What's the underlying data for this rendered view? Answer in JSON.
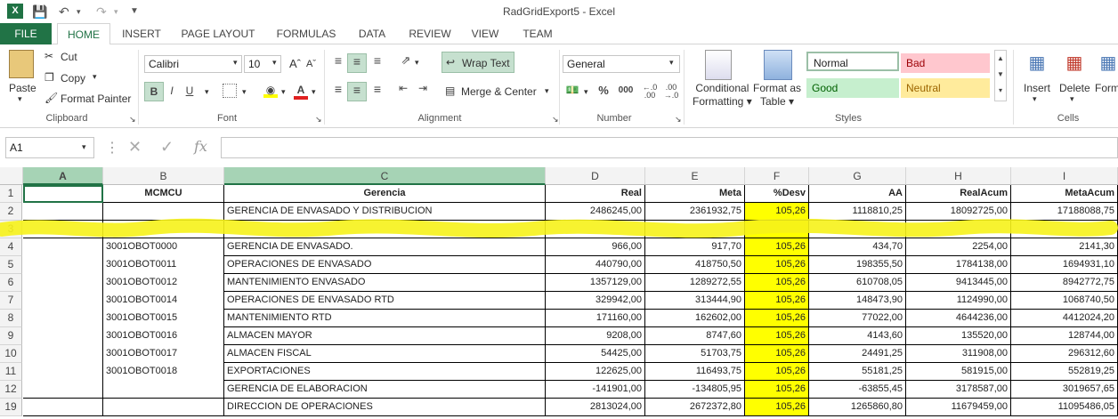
{
  "window": {
    "title": "RadGridExport5 - Excel"
  },
  "tabs": [
    "FILE",
    "HOME",
    "INSERT",
    "PAGE LAYOUT",
    "FORMULAS",
    "DATA",
    "REVIEW",
    "VIEW",
    "TEAM"
  ],
  "clipboard": {
    "paste": "Paste",
    "cut": "Cut",
    "copy": "Copy",
    "format_painter": "Format Painter",
    "label": "Clipboard"
  },
  "font": {
    "name": "Calibri",
    "size": "10",
    "bold": "B",
    "italic": "I",
    "underline": "U",
    "label": "Font"
  },
  "alignment": {
    "wrap": "Wrap Text",
    "merge": "Merge & Center",
    "label": "Alignment"
  },
  "number": {
    "format": "General",
    "percent": "%",
    "comma": "000",
    "label": "Number"
  },
  "styles": {
    "cond1": "Conditional",
    "cond2": "Formatting",
    "fmt1": "Format as",
    "fmt2": "Table",
    "normal": "Normal",
    "bad": "Bad",
    "good": "Good",
    "neutral": "Neutral",
    "label": "Styles"
  },
  "cells": {
    "insert": "Insert",
    "delete": "Delete",
    "format": "Form",
    "label": "Cells"
  },
  "formula_bar": {
    "name_box": "A1",
    "fx": "fx",
    "value": ""
  },
  "sheet": {
    "columns": [
      "A",
      "B",
      "C",
      "D",
      "E",
      "F",
      "G",
      "H",
      "I"
    ],
    "rows": [
      {
        "n": "1",
        "b": "MCMCU",
        "c": "Gerencia",
        "d": "Real",
        "e": "Meta",
        "f": "%Desv",
        "g": "AA",
        "h": "RealAcum",
        "i": "MetaAcum"
      },
      {
        "n": "2",
        "b": "",
        "c": "GERENCIA DE ENVASADO Y DISTRIBUCION",
        "d": "2486245,00",
        "e": "2361932,75",
        "f": "105,26",
        "g": "1118810,25",
        "h": "18092725,00",
        "i": "17188088,75"
      },
      {
        "n": "3",
        "b": "",
        "c": "",
        "d": "",
        "e": "",
        "f": "",
        "g": "",
        "h": "",
        "i": ""
      },
      {
        "n": "4",
        "b": "3001OBOT0000",
        "c": "GERENCIA DE ENVASADO.",
        "d": "966,00",
        "e": "917,70",
        "f": "105,26",
        "g": "434,70",
        "h": "2254,00",
        "i": "2141,30"
      },
      {
        "n": "5",
        "b": "3001OBOT0011",
        "c": "OPERACIONES DE ENVASADO",
        "d": "440790,00",
        "e": "418750,50",
        "f": "105,26",
        "g": "198355,50",
        "h": "1784138,00",
        "i": "1694931,10"
      },
      {
        "n": "6",
        "b": "3001OBOT0012",
        "c": "MANTENIMIENTO ENVASADO",
        "d": "1357129,00",
        "e": "1289272,55",
        "f": "105,26",
        "g": "610708,05",
        "h": "9413445,00",
        "i": "8942772,75"
      },
      {
        "n": "7",
        "b": "3001OBOT0014",
        "c": "OPERACIONES DE ENVASADO RTD",
        "d": "329942,00",
        "e": "313444,90",
        "f": "105,26",
        "g": "148473,90",
        "h": "1124990,00",
        "i": "1068740,50"
      },
      {
        "n": "8",
        "b": "3001OBOT0015",
        "c": "MANTENIMIENTO RTD",
        "d": "171160,00",
        "e": "162602,00",
        "f": "105,26",
        "g": "77022,00",
        "h": "4644236,00",
        "i": "4412024,20"
      },
      {
        "n": "9",
        "b": "3001OBOT0016",
        "c": "ALMACEN MAYOR",
        "d": "9208,00",
        "e": "8747,60",
        "f": "105,26",
        "g": "4143,60",
        "h": "135520,00",
        "i": "128744,00"
      },
      {
        "n": "10",
        "b": "3001OBOT0017",
        "c": "ALMACEN FISCAL",
        "d": "54425,00",
        "e": "51703,75",
        "f": "105,26",
        "g": "24491,25",
        "h": "311908,00",
        "i": "296312,60"
      },
      {
        "n": "11",
        "b": "3001OBOT0018",
        "c": "EXPORTACIONES",
        "d": "122625,00",
        "e": "116493,75",
        "f": "105,26",
        "g": "55181,25",
        "h": "581915,00",
        "i": "552819,25"
      },
      {
        "n": "12",
        "b": "",
        "c": "GERENCIA DE ELABORACION",
        "d": "-141901,00",
        "e": "-134805,95",
        "f": "105,26",
        "g": "-63855,45",
        "h": "3178587,00",
        "i": "3019657,65"
      },
      {
        "n": "19",
        "b": "",
        "c": "DIRECCION DE OPERACIONES",
        "d": "2813024,00",
        "e": "2672372,80",
        "f": "105,26",
        "g": "1265860,80",
        "h": "11679459,00",
        "i": "11095486,05"
      }
    ]
  },
  "colors": {
    "excel_green": "#217346",
    "highlight": "#ffff00"
  }
}
